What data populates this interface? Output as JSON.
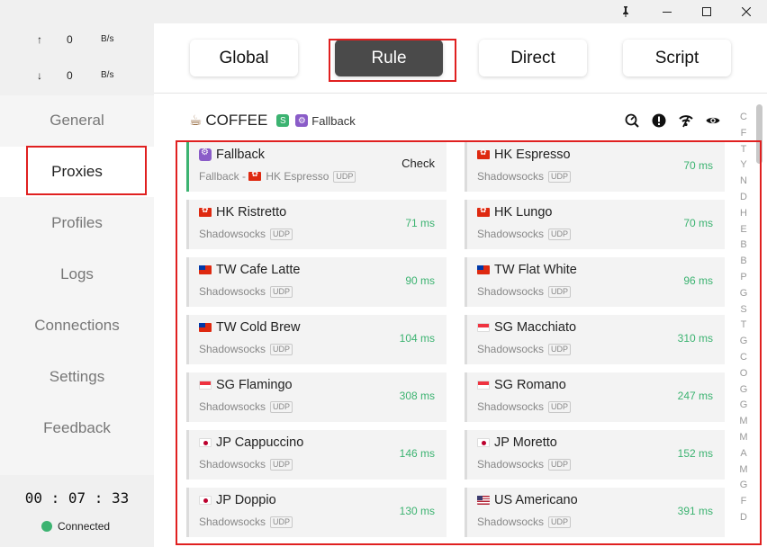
{
  "window": {
    "pin_icon": "pin-icon",
    "minimize_icon": "minimize-icon",
    "maximize_icon": "maximize-icon",
    "close_icon": "close-icon"
  },
  "traffic": {
    "upload": {
      "arrow": "↑",
      "value": "0",
      "unit": "B/s"
    },
    "download": {
      "arrow": "↓",
      "value": "0",
      "unit": "B/s"
    }
  },
  "nav": [
    "General",
    "Proxies",
    "Profiles",
    "Logs",
    "Connections",
    "Settings",
    "Feedback"
  ],
  "nav_active": "Proxies",
  "status": {
    "timer": "00 : 07 : 33",
    "connection": "Connected",
    "connection_color": "#3cb371"
  },
  "modes": [
    "Global",
    "Rule",
    "Direct",
    "Script"
  ],
  "mode_active": "Rule",
  "group": {
    "icon": "☕",
    "name": "COFFEE",
    "badge": "S",
    "type": "Fallback"
  },
  "toolbar_icons": [
    "speed-test-icon",
    "info-icon",
    "wifi-icon",
    "eye-icon"
  ],
  "proxies": [
    {
      "name": "Fallback",
      "flag": "fb",
      "type": "Fallback",
      "via": "HK Espresso",
      "via_flag": "hk",
      "udp": "UDP",
      "delay": "Check",
      "selected": true
    },
    {
      "name": "HK Espresso",
      "flag": "hk",
      "type": "Shadowsocks",
      "udp": "UDP",
      "delay": "70 ms"
    },
    {
      "name": "HK Ristretto",
      "flag": "hk",
      "type": "Shadowsocks",
      "udp": "UDP",
      "delay": "71 ms"
    },
    {
      "name": "HK Lungo",
      "flag": "hk",
      "type": "Shadowsocks",
      "udp": "UDP",
      "delay": "70 ms"
    },
    {
      "name": "TW Cafe Latte",
      "flag": "tw",
      "type": "Shadowsocks",
      "udp": "UDP",
      "delay": "90 ms"
    },
    {
      "name": "TW Flat White",
      "flag": "tw",
      "type": "Shadowsocks",
      "udp": "UDP",
      "delay": "96 ms"
    },
    {
      "name": "TW Cold Brew",
      "flag": "tw",
      "type": "Shadowsocks",
      "udp": "UDP",
      "delay": "104 ms"
    },
    {
      "name": "SG Macchiato",
      "flag": "sg",
      "type": "Shadowsocks",
      "udp": "UDP",
      "delay": "310 ms"
    },
    {
      "name": "SG Flamingo",
      "flag": "sg",
      "type": "Shadowsocks",
      "udp": "UDP",
      "delay": "308 ms"
    },
    {
      "name": "SG Romano",
      "flag": "sg",
      "type": "Shadowsocks",
      "udp": "UDP",
      "delay": "247 ms"
    },
    {
      "name": "JP Cappuccino",
      "flag": "jp",
      "type": "Shadowsocks",
      "udp": "UDP",
      "delay": "146 ms"
    },
    {
      "name": "JP Moretto",
      "flag": "jp",
      "type": "Shadowsocks",
      "udp": "UDP",
      "delay": "152 ms"
    },
    {
      "name": "JP Doppio",
      "flag": "jp",
      "type": "Shadowsocks",
      "udp": "UDP",
      "delay": "130 ms"
    },
    {
      "name": "US Americano",
      "flag": "us",
      "type": "Shadowsocks",
      "udp": "UDP",
      "delay": "391 ms"
    }
  ],
  "alphabet": [
    "C",
    "F",
    "T",
    "Y",
    "N",
    "D",
    "H",
    "E",
    "B",
    "B",
    "P",
    "G",
    "S",
    "T",
    "G",
    "C",
    "O",
    "G",
    "G",
    "M",
    "M",
    "A",
    "M",
    "G",
    "F",
    "D"
  ]
}
